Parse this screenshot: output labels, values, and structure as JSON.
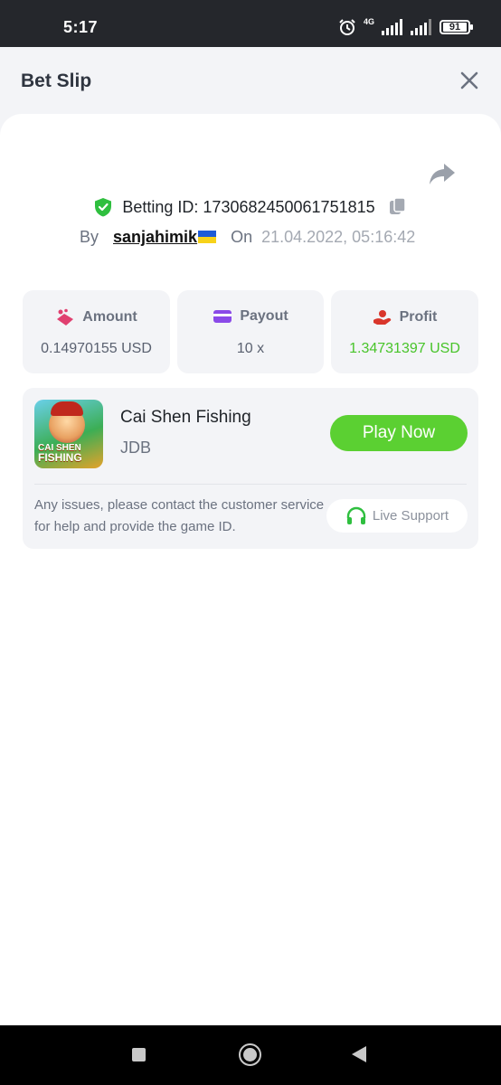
{
  "status_bar": {
    "time": "5:17",
    "network_label": "4G",
    "battery_level": "91",
    "icons": [
      "alarm-icon",
      "signal-icon",
      "signal-icon",
      "battery-icon"
    ]
  },
  "header": {
    "title": "Bet Slip",
    "close_icon": "close-icon"
  },
  "bet": {
    "betting_id_text": "Betting ID: 1730682450061751815",
    "by_label": "By",
    "username": "sanjahimik",
    "flag": "ukraine-flag",
    "on_label": "On",
    "date": "21.04.2022, 05:16:42"
  },
  "stats": [
    {
      "title": "Amount",
      "value": "0.14970155 USD",
      "icon": "amount-icon",
      "color": "#e04070"
    },
    {
      "title": "Payout",
      "value": "10 x",
      "icon": "wallet-icon",
      "color": "#8a4ae8"
    },
    {
      "title": "Profit",
      "value": "1.34731397 USD",
      "icon": "profit-icon",
      "color": "#d9362b",
      "value_color": "#48c42a"
    }
  ],
  "game": {
    "thumb_line1": "CAI SHEN",
    "thumb_line2": "FISHING",
    "name": "Cai Shen Fishing",
    "provider": "JDB",
    "play_label": "Play Now",
    "issue_text": "Any issues, please contact the customer service for help and provide the game ID.",
    "support_label": "Live Support"
  },
  "colors": {
    "accent_green": "#5bd032",
    "card_bg": "#f3f4f7"
  }
}
